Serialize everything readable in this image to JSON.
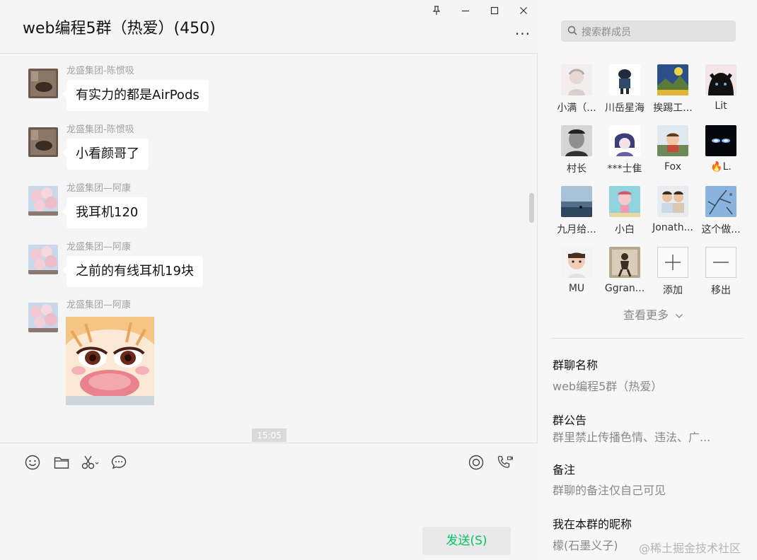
{
  "window": {
    "title": "web编程5群（热爱）(450)",
    "controls": {
      "pin": "pin-icon",
      "minimize": "minimize-icon",
      "maximize": "maximize-icon",
      "close": "close-icon"
    },
    "more": "···"
  },
  "messages": [
    {
      "sender": "龙盛集团-陈惯吸",
      "text": "有实力的都是AirPods"
    },
    {
      "sender": "龙盛集团-陈惯吸",
      "text": "小看颜哥了"
    },
    {
      "sender": "龙盛集团—阿康",
      "text": "我耳机120"
    },
    {
      "sender": "龙盛集团—阿康",
      "text": "之前的有线耳机19块"
    },
    {
      "sender": "龙盛集团—阿康",
      "sticker": "crying-anime-sticker"
    }
  ],
  "time_divider": "15:05",
  "composer": {
    "tools_left": [
      "emoji-icon",
      "folder-icon",
      "scissors-icon",
      "chat-record-icon"
    ],
    "tools_right": [
      "live-icon",
      "call-icon"
    ],
    "send_label": "发送(S)"
  },
  "side": {
    "search_placeholder": "搜索群成员",
    "members": [
      {
        "name": "小满（..."
      },
      {
        "name": "川岳星海"
      },
      {
        "name": "挨踢工..."
      },
      {
        "name": "Lit"
      },
      {
        "name": "村长"
      },
      {
        "name": "***士隹"
      },
      {
        "name": "Fox"
      },
      {
        "name": "L."
      },
      {
        "name": "九月给..."
      },
      {
        "name": "小白"
      },
      {
        "name": "Jonath..."
      },
      {
        "name": "这个做..."
      },
      {
        "name": "MU"
      },
      {
        "name": "Ggran..."
      }
    ],
    "add_label": "添加",
    "remove_label": "移出",
    "see_more": "查看更多",
    "group_name_label": "群聊名称",
    "group_name_value": "web编程5群（热爱）",
    "notice_label": "群公告",
    "notice_value": "群里禁止传播色情、违法、广...",
    "remark_label": "备注",
    "remark_value": "群聊的备注仅自己可见",
    "nickname_label": "我在本群的昵称",
    "nickname_value": "檬(石墨义子)",
    "watermark": "@稀土掘金技术社区"
  }
}
